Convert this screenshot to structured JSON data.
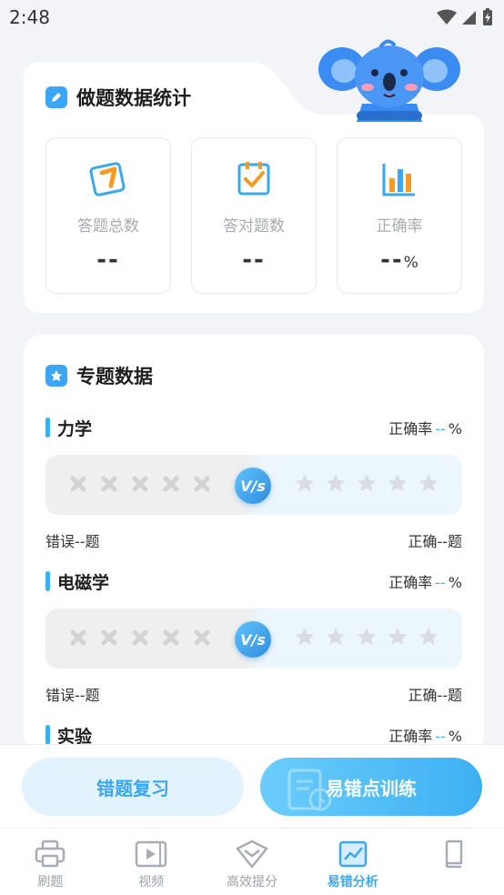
{
  "status_bar": {
    "time": "2:48"
  },
  "colors": {
    "accent": "#3aa8ef",
    "card_bg": "#ffffff",
    "page_bg": "#f3f4f8"
  },
  "stats": {
    "title": "做题数据统计",
    "items": [
      {
        "label": "答题总数",
        "value": "--",
        "unit": "",
        "icon": "pencil-box-icon"
      },
      {
        "label": "答对题数",
        "value": "--",
        "unit": "",
        "icon": "checkbox-icon"
      },
      {
        "label": "正确率",
        "value": "--",
        "unit": "%",
        "icon": "bar-chart-icon"
      }
    ]
  },
  "topics": {
    "title": "专题数据",
    "accuracy_prefix": "正确率",
    "accuracy_value": "--",
    "accuracy_unit": "%",
    "vs_label": "V/s",
    "items": [
      {
        "name": "力学",
        "wrong": "错误--题",
        "correct": "正确--题"
      },
      {
        "name": "电磁学",
        "wrong": "错误--题",
        "correct": "正确--题"
      },
      {
        "name": "实验"
      }
    ]
  },
  "buttons": {
    "review": "错题复习",
    "train": "易错点训练"
  },
  "tabs": [
    {
      "label": "刷题",
      "icon": "printer-icon"
    },
    {
      "label": "视频",
      "icon": "video-icon"
    },
    {
      "label": "高效提分",
      "icon": "chevron-shield-icon"
    },
    {
      "label": "易错分析",
      "icon": "trend-chart-icon",
      "active": true
    },
    {
      "label": "",
      "icon": "book-icon"
    }
  ]
}
